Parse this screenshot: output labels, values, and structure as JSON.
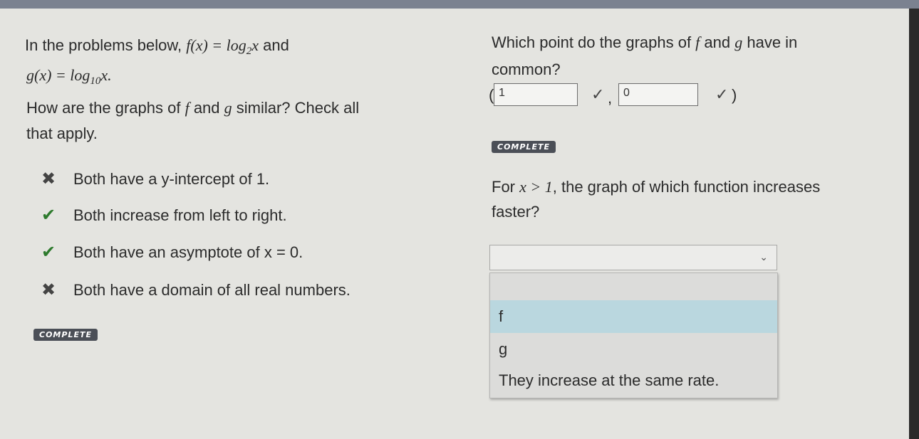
{
  "left": {
    "intro_prefix": "In the problems below, ",
    "intro_f": "f(x) = log",
    "intro_f_sub": "2",
    "intro_f_tail": "x",
    "intro_and": " and",
    "intro_g": "g(x) = log",
    "intro_g_sub": "10",
    "intro_g_tail": "x.",
    "question_line1": "How are the graphs of ",
    "question_f": "f",
    "question_mid": " and ",
    "question_g": "g",
    "question_end": " similar? Check all",
    "question_line2": "that apply.",
    "options": [
      {
        "mark": "✖",
        "text": "Both have a y-intercept of 1."
      },
      {
        "mark": "✔",
        "text": "Both increase from left to right."
      },
      {
        "mark": "✔",
        "text": "Both have an asymptote of x = 0."
      },
      {
        "mark": "✖",
        "text": "Both have a domain of all real numbers."
      }
    ],
    "status": "COMPLETE"
  },
  "right": {
    "q1_part1": "Which point do the graphs of ",
    "q1_f": "f",
    "q1_mid": " and ",
    "q1_g": "g",
    "q1_tail": " have in",
    "q1_line2": "common?",
    "open_paren": "(",
    "comma": ",",
    "close_paren": ")",
    "x_value": "1",
    "y_value": "0",
    "checkmark": "✓",
    "status": "COMPLETE",
    "q2_prefix": "For ",
    "q2_cond": "x > 1",
    "q2_rest": ", the graph of which function increases",
    "q2_line2": "faster?",
    "dropdown": {
      "selected": "",
      "chevron": "⌄",
      "options": [
        "f",
        "g",
        "They increase at the same rate."
      ],
      "highlighted_index": 0
    }
  }
}
